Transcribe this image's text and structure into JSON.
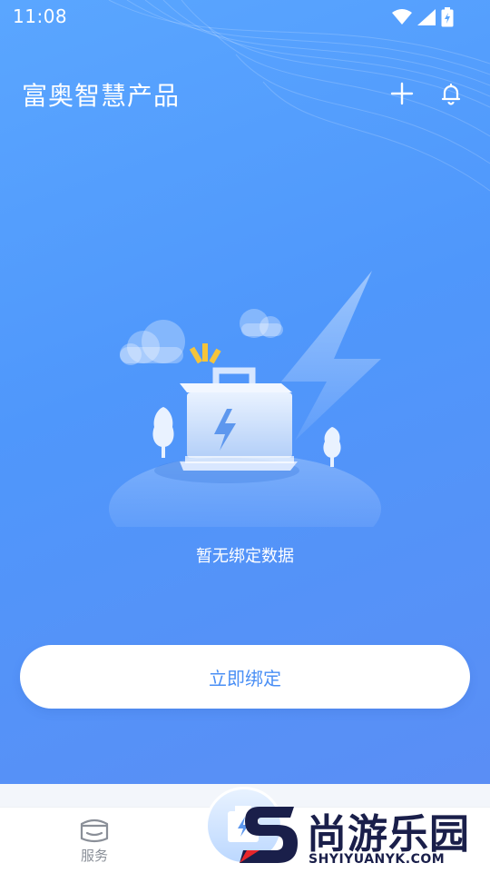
{
  "status_bar": {
    "time": "11:08"
  },
  "header": {
    "title": "富奥智慧产品"
  },
  "empty_state": {
    "message": "暂无绑定数据"
  },
  "actions": {
    "bind_now": "立即绑定"
  },
  "tab_bar": {
    "service_label": "服务"
  },
  "watermark": {
    "brand": "尚游乐园",
    "site": "SHYIYUANYK.COM"
  },
  "colors": {
    "accent": "#4a8ff5",
    "bg_top": "#5aa6ff",
    "bg_bottom": "#5a8ef5",
    "watermark": "#1a1f4a",
    "watermark_red": "#e8262b"
  },
  "icons": [
    "wifi-icon",
    "signal-icon",
    "battery-icon",
    "plus-icon",
    "bell-icon",
    "service-icon"
  ]
}
